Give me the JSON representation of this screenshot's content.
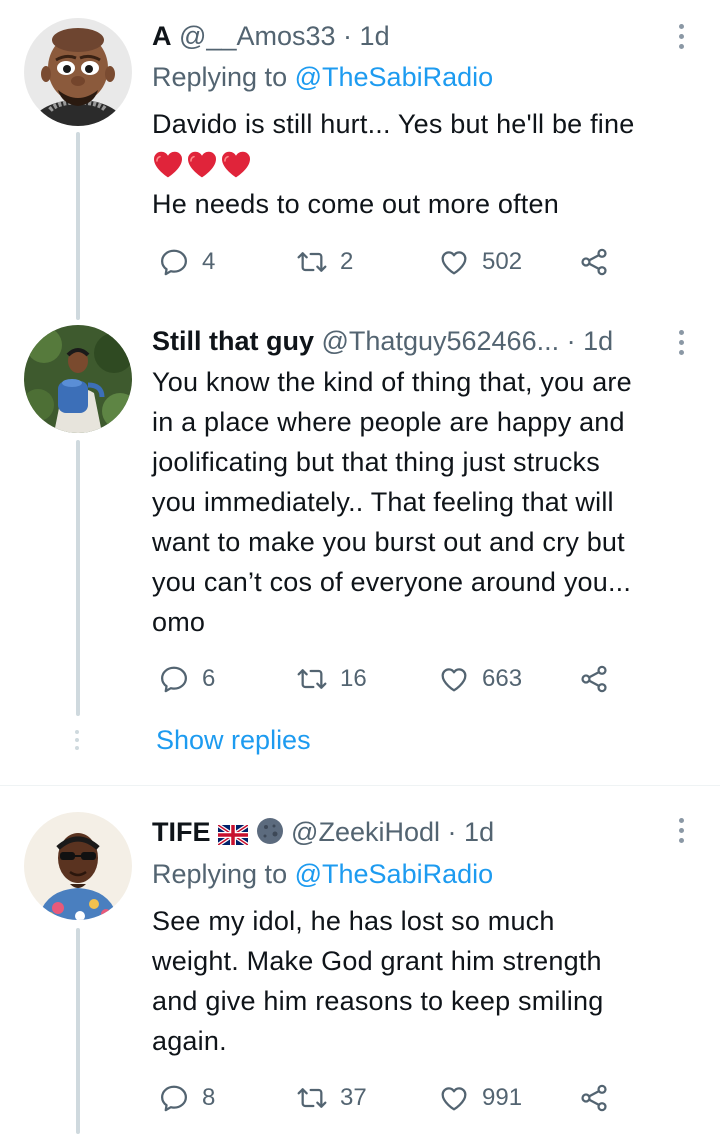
{
  "tweets": [
    {
      "name": "A",
      "handle": "@__Amos33",
      "dot": "·",
      "time": "1d",
      "replying_prefix": "Replying to",
      "replying_to": "@TheSabiRadio",
      "lines": [
        "Davido is still hurt... Yes but he'll be fine"
      ],
      "hearts_count": 3,
      "lines_after": [
        "He needs to come out more often"
      ],
      "replies": "4",
      "retweets": "2",
      "likes": "502"
    },
    {
      "name": "Still that guy",
      "handle": "@Thatguy562466...",
      "dot": "·",
      "time": "1d",
      "lines": [
        "You know the kind of thing that, you are",
        "in a place where people are happy and",
        "joolificating but that thing just strucks",
        "you immediately.. That feeling that will",
        "want to make you burst out and cry but",
        "you can’t cos of everyone around you...",
        "omo"
      ],
      "replies": "6",
      "retweets": "16",
      "likes": "663",
      "show_replies": "Show replies"
    },
    {
      "name": "TIFE",
      "handle": "@ZeekiHodl",
      "dot": "·",
      "time": "1d",
      "replying_prefix": "Replying to",
      "replying_to": "@TheSabiRadio",
      "lines": [
        "See my idol, he has lost so much",
        "weight. Make God grant him strength",
        "and give him reasons to keep smiling",
        "again."
      ],
      "replies": "8",
      "retweets": "37",
      "likes": "991"
    }
  ],
  "icons": {
    "reply": "reply-icon",
    "retweet": "retweet-icon",
    "like": "heart-icon",
    "share": "share-icon",
    "more": "more-options-icon"
  },
  "colors": {
    "link": "#1d9bf0",
    "secondary": "#536471",
    "heart_emoji": "#e0243a",
    "thread_line": "#cfd9de"
  }
}
